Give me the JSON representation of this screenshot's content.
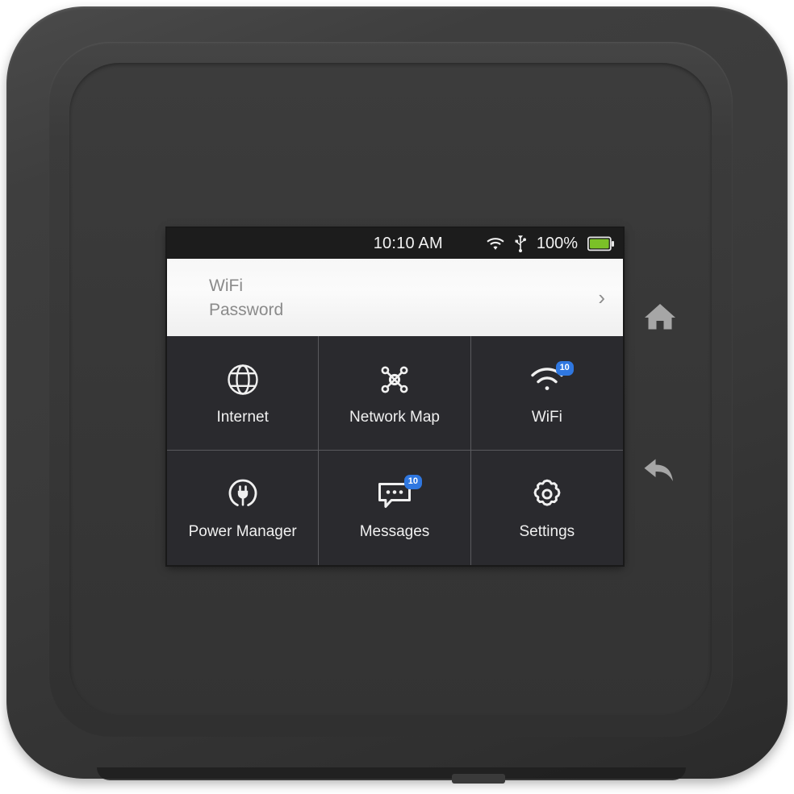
{
  "device": {
    "name": "mobile-hotspot-device",
    "body_color": "#3a3a3a",
    "screen_bg": "#1b1b1b"
  },
  "status_bar": {
    "time": "10:10 AM",
    "battery_percent": "100%",
    "icons": [
      "wifi-icon",
      "usb-icon",
      "battery-icon"
    ],
    "battery_fill_color": "#7bc127"
  },
  "wifi_card": {
    "line1": "WiFi",
    "line2": "Password",
    "chevron": "›"
  },
  "apps": [
    {
      "label": "Internet",
      "icon": "globe-icon",
      "badge": null
    },
    {
      "label": "Network Map",
      "icon": "network-map-icon",
      "badge": null
    },
    {
      "label": "WiFi",
      "icon": "wifi-signal-icon",
      "badge": "10"
    },
    {
      "label": "Power Manager",
      "icon": "power-plug-icon",
      "badge": null
    },
    {
      "label": "Messages",
      "icon": "message-bubble-icon",
      "badge": "10"
    },
    {
      "label": "Settings",
      "icon": "gear-icon",
      "badge": null
    }
  ],
  "hardware_buttons": [
    {
      "name": "home-button",
      "icon": "home-icon"
    },
    {
      "name": "back-button",
      "icon": "back-arrow-icon"
    }
  ],
  "colors": {
    "badge_blue": "#2f77e0",
    "tile_bg": "#2a2a2e",
    "tile_divider": "#5a5a5e",
    "card_text": "#8a8a8a"
  }
}
